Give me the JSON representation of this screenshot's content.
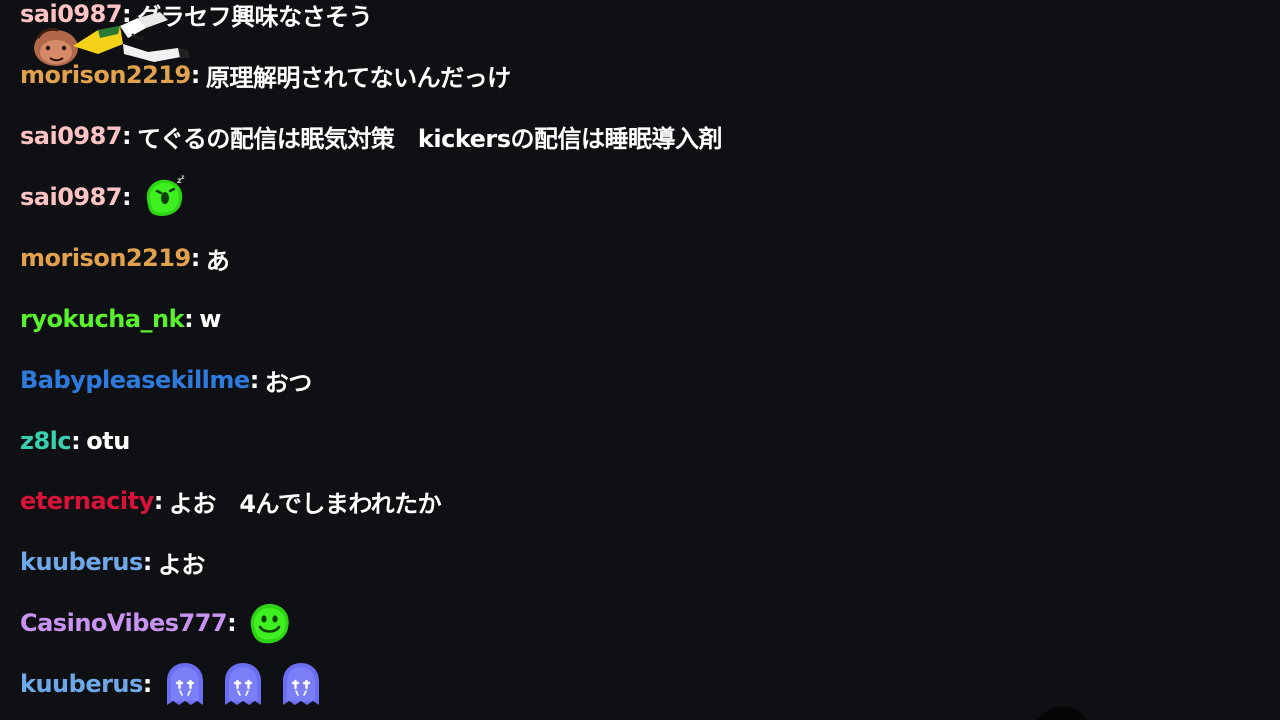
{
  "colors": {
    "background": "#0f1013",
    "message_text": "#ffffff"
  },
  "messages": [
    {
      "user": "sai0987",
      "color": "#ffc3c3",
      "text": "グラセフ興味なさそう"
    },
    {
      "user": "morison2219",
      "color": "#e1a14d",
      "text": "原理解明されてないんだっけ"
    },
    {
      "user": "sai0987",
      "color": "#ffc3c3",
      "text": "てぐるの配信は眠気対策　kickersの配信は睡眠導入剤"
    },
    {
      "user": "sai0987",
      "color": "#ffc3c3",
      "text": "",
      "emotes": [
        "green-sleepy-blob-emote"
      ]
    },
    {
      "user": "morison2219",
      "color": "#e1a14d",
      "text": "あ"
    },
    {
      "user": "ryokucha_nk",
      "color": "#59f32e",
      "text": "w"
    },
    {
      "user": "Babypleasekillme",
      "color": "#2e7bdf",
      "text": "おつ"
    },
    {
      "user": "z8lc",
      "color": "#38cfb0",
      "text": "otu"
    },
    {
      "user": "eternacity",
      "color": "#d9123a",
      "text": "よお　4んでしまわれたか"
    },
    {
      "user": "kuuberus",
      "color": "#6fa8e8",
      "text": "よお"
    },
    {
      "user": "CasinoVibes777",
      "color": "#c993f2",
      "text": "",
      "emotes": [
        "green-smile-blob-emote"
      ]
    },
    {
      "user": "kuuberus",
      "color": "#6fa8e8",
      "text": "",
      "emotes": [
        "blue-ghost-emote",
        "blue-ghost-emote",
        "blue-ghost-emote"
      ]
    }
  ],
  "sticker": {
    "icon": "dancing-character-sticker"
  }
}
